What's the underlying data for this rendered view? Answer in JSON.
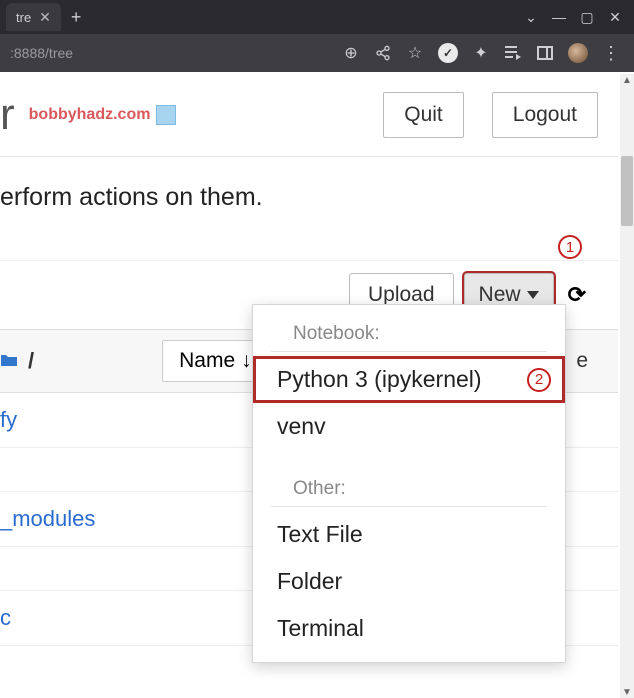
{
  "browser": {
    "tab_title": "tre",
    "url_fragment": ":8888/tree"
  },
  "header": {
    "logo_letter": "r",
    "brand_text": "bobbyhadz.com",
    "quit_label": "Quit",
    "logout_label": "Logout"
  },
  "instruction": "erform actions on them.",
  "toolbar": {
    "upload_label": "Upload",
    "new_label": "New",
    "annotation1": "1"
  },
  "listing": {
    "breadcrumb_sep": "/",
    "name_label": "Name",
    "right_partial": "e"
  },
  "files": [
    {
      "name": "fy"
    },
    {
      "name": ""
    },
    {
      "name": "_modules"
    },
    {
      "name": ""
    },
    {
      "name": "c"
    }
  ],
  "dropdown": {
    "section_notebook": "Notebook:",
    "item_python3": "Python 3 (ipykernel)",
    "annotation2": "2",
    "item_venv": "venv",
    "section_other": "Other:",
    "item_textfile": "Text File",
    "item_folder": "Folder",
    "item_terminal": "Terminal"
  }
}
